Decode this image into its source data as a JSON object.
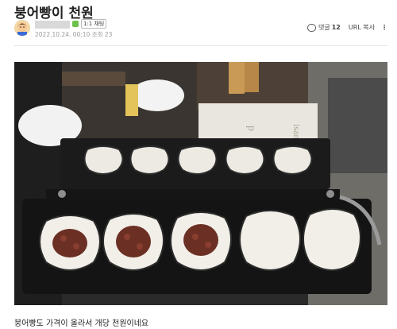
{
  "post": {
    "title": "붕어빵이 천원",
    "author_badge": "1:1 채팅",
    "date": "2022.10.24. 00:10",
    "views_label": "조회 23",
    "comments_label": "댓글",
    "comments_count": "12",
    "url_copy": "URL 복사",
    "more_icon": "⋮",
    "body_text": "붕어빵도 가격이 올라서 개당 천원이네요"
  },
  "icons": {
    "comment": "comment-icon",
    "more": "kebab-icon"
  },
  "photo": {
    "alt": "붕어빵 틀 사진"
  }
}
